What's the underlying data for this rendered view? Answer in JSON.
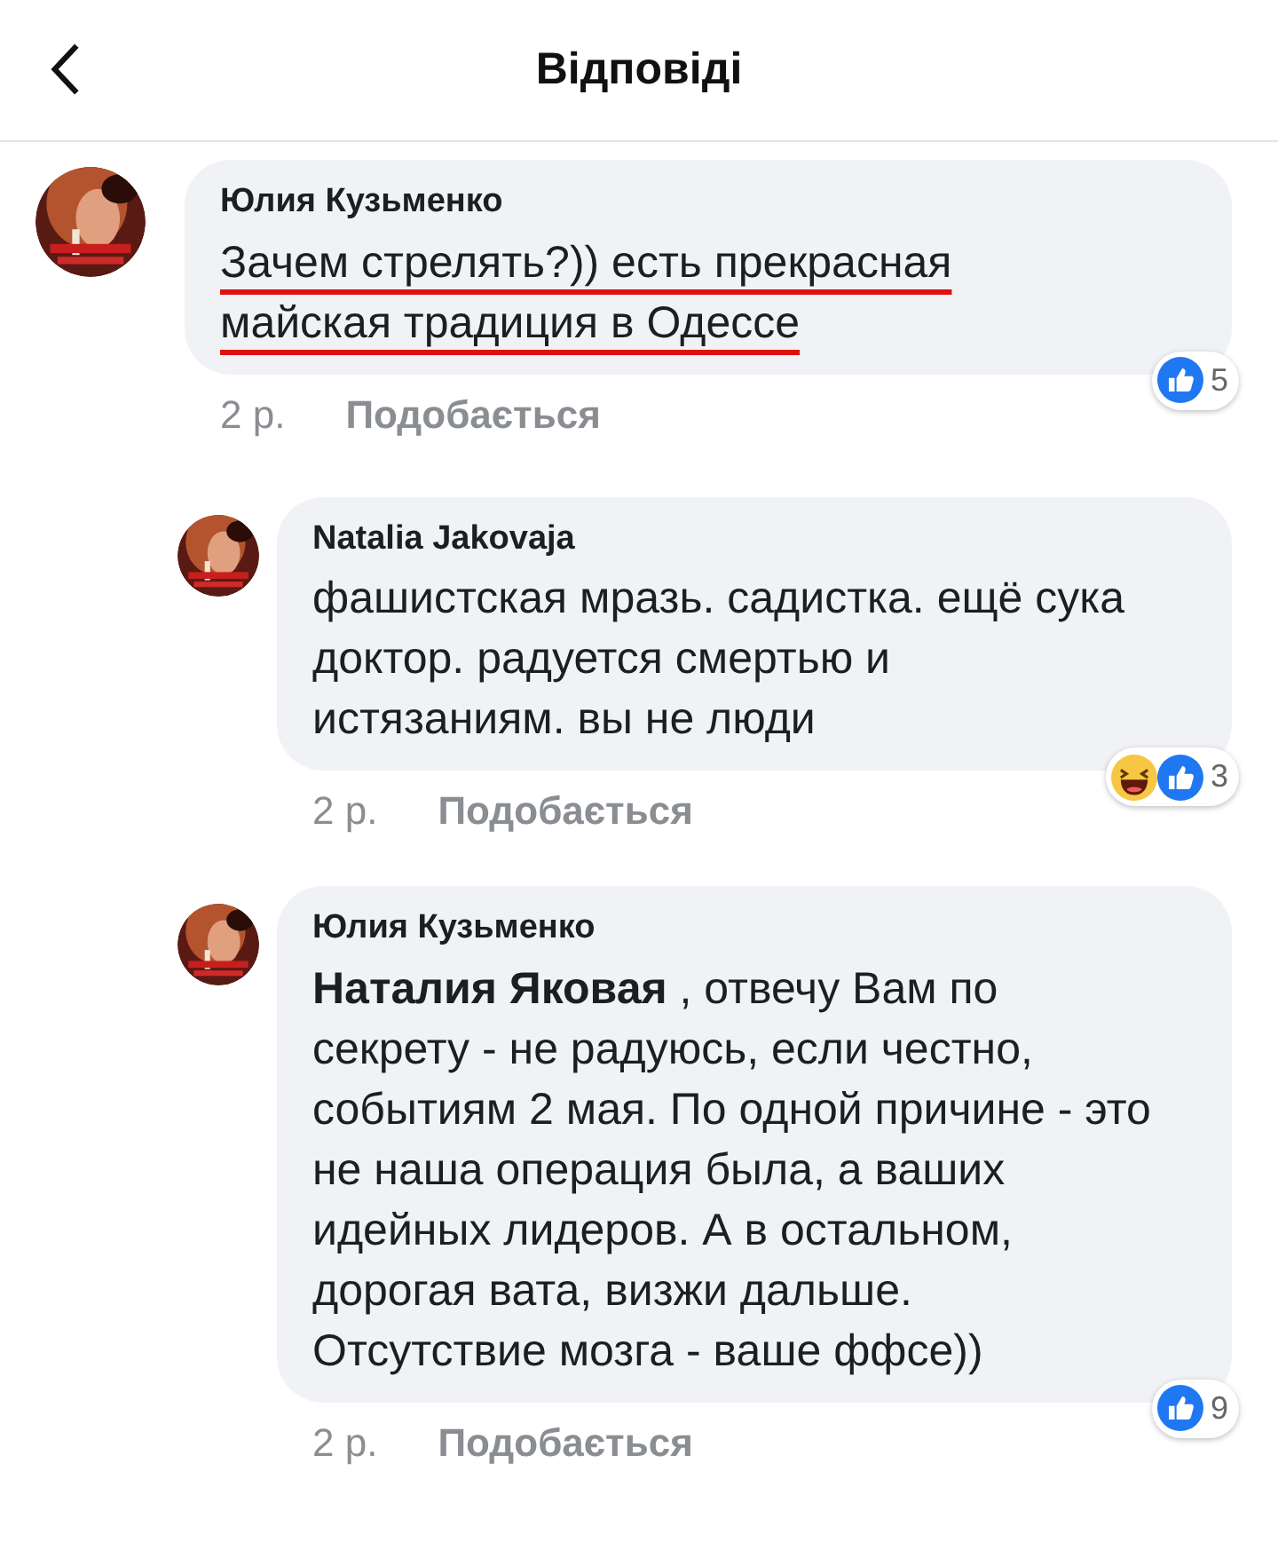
{
  "header": {
    "title": "Відповіді"
  },
  "comments": [
    {
      "author": "Юлия Кузьменко",
      "text": "Зачем стрелять?)) есть прекрасная майская традиция в Одессе",
      "underlined": true,
      "reply": false,
      "time": "2 р.",
      "like_label": "Подобається",
      "reactions": [
        {
          "kind": "like"
        }
      ],
      "reaction_count": "5"
    },
    {
      "author": "Natalia Jakovaja",
      "text": "фашистская мразь. садистка. ещё сука доктор. радуется смертью и истязаниям. вы не люди",
      "underlined": false,
      "reply": true,
      "time": "2 р.",
      "like_label": "Подобається",
      "reactions": [
        {
          "kind": "haha"
        },
        {
          "kind": "like"
        }
      ],
      "reaction_count": "3"
    },
    {
      "author": "Юлия Кузьменко",
      "text": "**Наталия Яковая** , отвечу Вам по секрету - не радуюсь, если честно, событиям 2 мая. По одной причине - это не наша операция была, а ваших идейных лидеров. А в остальном, дорогая вата, визжи дальше. Отсутствие мозга - ваше ффсе))",
      "underlined": false,
      "reply": true,
      "time": "2 р.",
      "like_label": "Подобається",
      "reactions": [
        {
          "kind": "like"
        }
      ],
      "reaction_count": "9"
    }
  ]
}
